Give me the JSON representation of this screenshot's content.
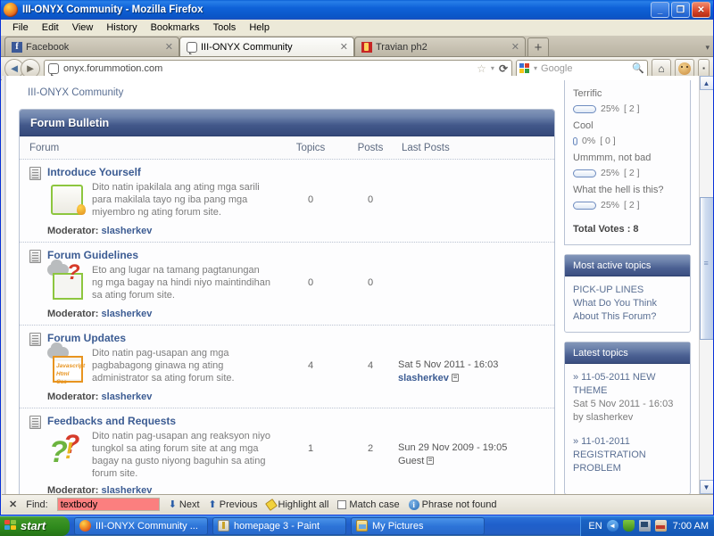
{
  "window": {
    "title": "III-ONYX Community - Mozilla Firefox",
    "minimize": "_",
    "restore": "❐",
    "close": "✕"
  },
  "menubar": {
    "items": [
      "File",
      "Edit",
      "View",
      "History",
      "Bookmarks",
      "Tools",
      "Help"
    ]
  },
  "tabs": [
    {
      "label": "Facebook",
      "icon": "facebook-icon",
      "active": false,
      "close": "✕"
    },
    {
      "label": "III-ONYX Community",
      "icon": "chat-bubble-icon",
      "active": true,
      "close": "✕"
    },
    {
      "label": "Travian ph2",
      "icon": "travian-icon",
      "active": false,
      "close": "✕"
    }
  ],
  "tabbar": {
    "new_tab": "+",
    "list_all_tabs": "▾"
  },
  "navbar": {
    "back": "◄",
    "forward": "►",
    "url": "onyx.forummotion.com",
    "url_icon": "chat-bubble-icon",
    "bookmark_star": "☆",
    "bookmark_dropdown": "▾",
    "reload": "⟳",
    "search_placeholder": "Google",
    "search_value": "Google",
    "search_engine_dropdown": "▾",
    "search_go": "🔍",
    "home": "⌂",
    "addon": "monkey-icon",
    "overflow": "▪"
  },
  "forum": {
    "breadcrumb": "III-ONYX Community",
    "bulletin_title": "Forum Bulletin",
    "columns": {
      "forum": "Forum",
      "topics": "Topics",
      "posts": "Posts",
      "last_posts": "Last Posts"
    },
    "moderator_label": "Moderator:",
    "rows": [
      {
        "title": "Introduce Yourself",
        "description": "Dito natin ipakilala ang ating mga sarili para makilala tayo ng iba pang mga miyembro ng ating forum site.",
        "thumb": "scroll-ribbon-icon",
        "moderator": "slasherkev",
        "topics": "0",
        "posts": "0",
        "last_post_date": "",
        "last_post_author": ""
      },
      {
        "title": "Forum Guidelines",
        "description": "Eto ang lugar na tamang pagtanungan ng mga bagay na hindi niyo maintindihan sa ating forum site.",
        "thumb": "question-box-icon",
        "moderator": "slasherkev",
        "topics": "0",
        "posts": "0",
        "last_post_date": "",
        "last_post_author": ""
      },
      {
        "title": "Forum Updates",
        "description": "Dito natin pag-usapan ang mga pagbabagong ginawa ng ating administrator sa ating forum site.",
        "thumb": "code-box-icon",
        "thumb_code": "Javascript Html Css",
        "moderator": "slasherkev",
        "topics": "4",
        "posts": "4",
        "last_post_date": "Sat 5 Nov 2011 - 16:03",
        "last_post_author": "slasherkev"
      },
      {
        "title": "Feedbacks and Requests",
        "description": "Dito natin pag-usapan ang reaksyon niyo tungkol sa ating forum site at ang mga bagay na gusto niyong baguhin sa ating forum site.",
        "thumb": "question-marks-icon",
        "moderator": "slasherkev",
        "topics": "1",
        "posts": "2",
        "last_post_date": "Sun 29 Nov 2009 - 19:05",
        "last_post_author": "Guest"
      }
    ]
  },
  "sidebar": {
    "poll": {
      "options": [
        {
          "label": "Terrific",
          "percent": "25%",
          "votes": "[ 2 ]",
          "bar": "w25"
        },
        {
          "label": "Cool",
          "percent": "0%",
          "votes": "[ 0 ]",
          "bar": "w0"
        },
        {
          "label": "Ummmm, not bad",
          "percent": "25%",
          "votes": "[ 2 ]",
          "bar": "w25"
        },
        {
          "label": "What the hell is this?",
          "percent": "25%",
          "votes": "[ 2 ]",
          "bar": "w25"
        }
      ],
      "total": "Total Votes : 8"
    },
    "most_active": {
      "title": "Most active topics",
      "items": [
        "PICK-UP LINES",
        "What Do You Think About This Forum?"
      ]
    },
    "latest": {
      "title": "Latest topics",
      "items": [
        {
          "title": "» 11-05-2011 NEW THEME",
          "date": "Sat 5 Nov 2011 - 16:03",
          "author": "by slasherkev"
        },
        {
          "title": "» 11-01-2011 REGISTRATION PROBLEM",
          "date": "",
          "author": ""
        }
      ]
    }
  },
  "scrollbar": {
    "up": "▲",
    "down": "▼"
  },
  "findbar": {
    "close": "✕",
    "label": "Find:",
    "value": "textbody",
    "next": "Next",
    "previous": "Previous",
    "highlight_all": "Highlight all",
    "match_case": "Match case",
    "status": "Phrase not found"
  },
  "taskbar": {
    "start": "start",
    "items": [
      {
        "label": "III-ONYX Community ...",
        "icon": "firefox-icon"
      },
      {
        "label": "homepage 3 - Paint",
        "icon": "paint-icon"
      },
      {
        "label": "My Pictures",
        "icon": "pictures-icon"
      }
    ],
    "tray": {
      "language": "EN",
      "icons": [
        "show-hidden-icons",
        "antivirus-shield-icon",
        "network-icon",
        "updates-icon"
      ],
      "clock": "7:00 AM"
    }
  },
  "colors": {
    "titlebar_blue": "#0f62d8",
    "forum_header_navy": "#35497a",
    "link_blue": "#3c5c93",
    "find_nomatch_red": "#fb7f7f",
    "start_green": "#2f8a1d"
  }
}
